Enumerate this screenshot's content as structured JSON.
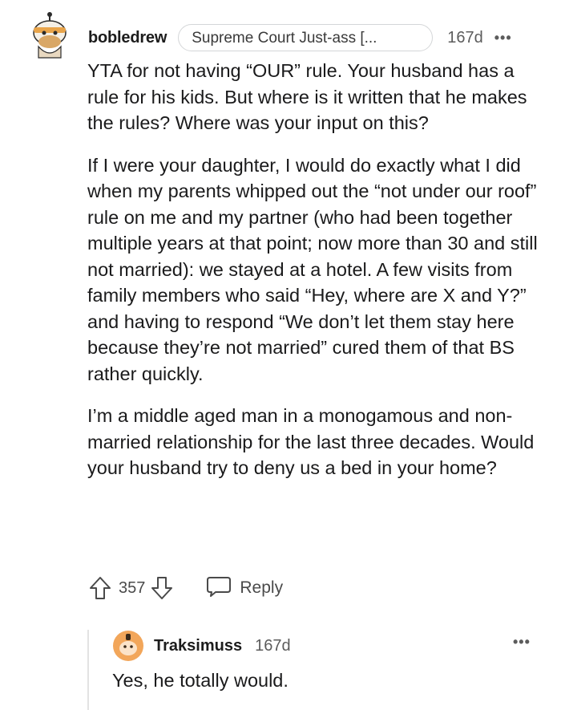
{
  "comment": {
    "username": "bobledrew",
    "flair": "Supreme Court Just-ass [...",
    "age": "167d",
    "more_icon": "ellipsis-icon",
    "paragraphs": [
      "YTA for not having “OUR” rule. Your husband has a rule for his kids. But where is it written that he makes the rules? Where was your input on this?",
      "If I were your daughter, I would do exactly what I did when my parents whipped out the “not under our roof” rule on me and my partner (who had been together multiple years at that point; now more than 30 and still not married): we stayed at a hotel. A few visits from family members who said “Hey, where are X and Y?” and having to respond “We don’t let them stay here because they’re not married” cured them of that BS rather quickly.",
      "I’m a middle aged man in a monogamous and non-married relationship for the last three decades. Would your husband try to deny us a bed in your home?"
    ],
    "score": "357",
    "reply_label": "Reply"
  },
  "reply": {
    "username": "Traksimuss",
    "age": "167d",
    "text": "Yes, he totally would.",
    "more_icon": "ellipsis-icon"
  },
  "more_glyph": "•••",
  "colors": {
    "text": "#1a1a1b",
    "meta": "#5c5c5c",
    "flair_border": "#d4d6d8",
    "thread_line": "#e3e3e3",
    "avatar_orange": "#f2a65a"
  }
}
